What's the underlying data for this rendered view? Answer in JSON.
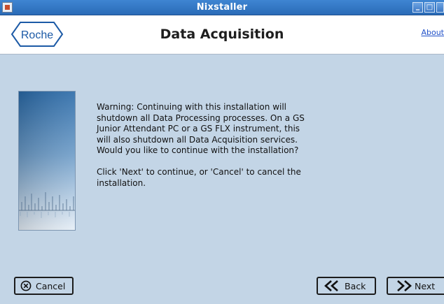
{
  "window": {
    "title": "Nixstaller",
    "minimize_glyph": "‗",
    "maximize_glyph": "□",
    "close_glyph": "✕"
  },
  "header": {
    "logo_text": "Roche",
    "title": "Data Acquisition",
    "about_link": "About"
  },
  "message": {
    "warning": "Warning: Continuing with this installation will shutdown all Data Processing processes.  On a GS Junior Attendant PC or a GS FLX instrument, this will also shutdown all Data Acquisition services.  Would you like to continue with the installation?",
    "instruction": "Click 'Next' to continue, or 'Cancel' to cancel the installation."
  },
  "buttons": {
    "cancel": "Cancel",
    "back": "Back",
    "next": "Next"
  },
  "icons": {
    "app": "app-icon",
    "cancel": "circle-x-icon",
    "back": "double-chevron-left-icon",
    "next": "double-chevron-right-icon"
  },
  "colors": {
    "titlebar": "#2f75c6",
    "background": "#c3d5e6",
    "logo_blue": "#1c5aa6",
    "link": "#2050c8"
  }
}
